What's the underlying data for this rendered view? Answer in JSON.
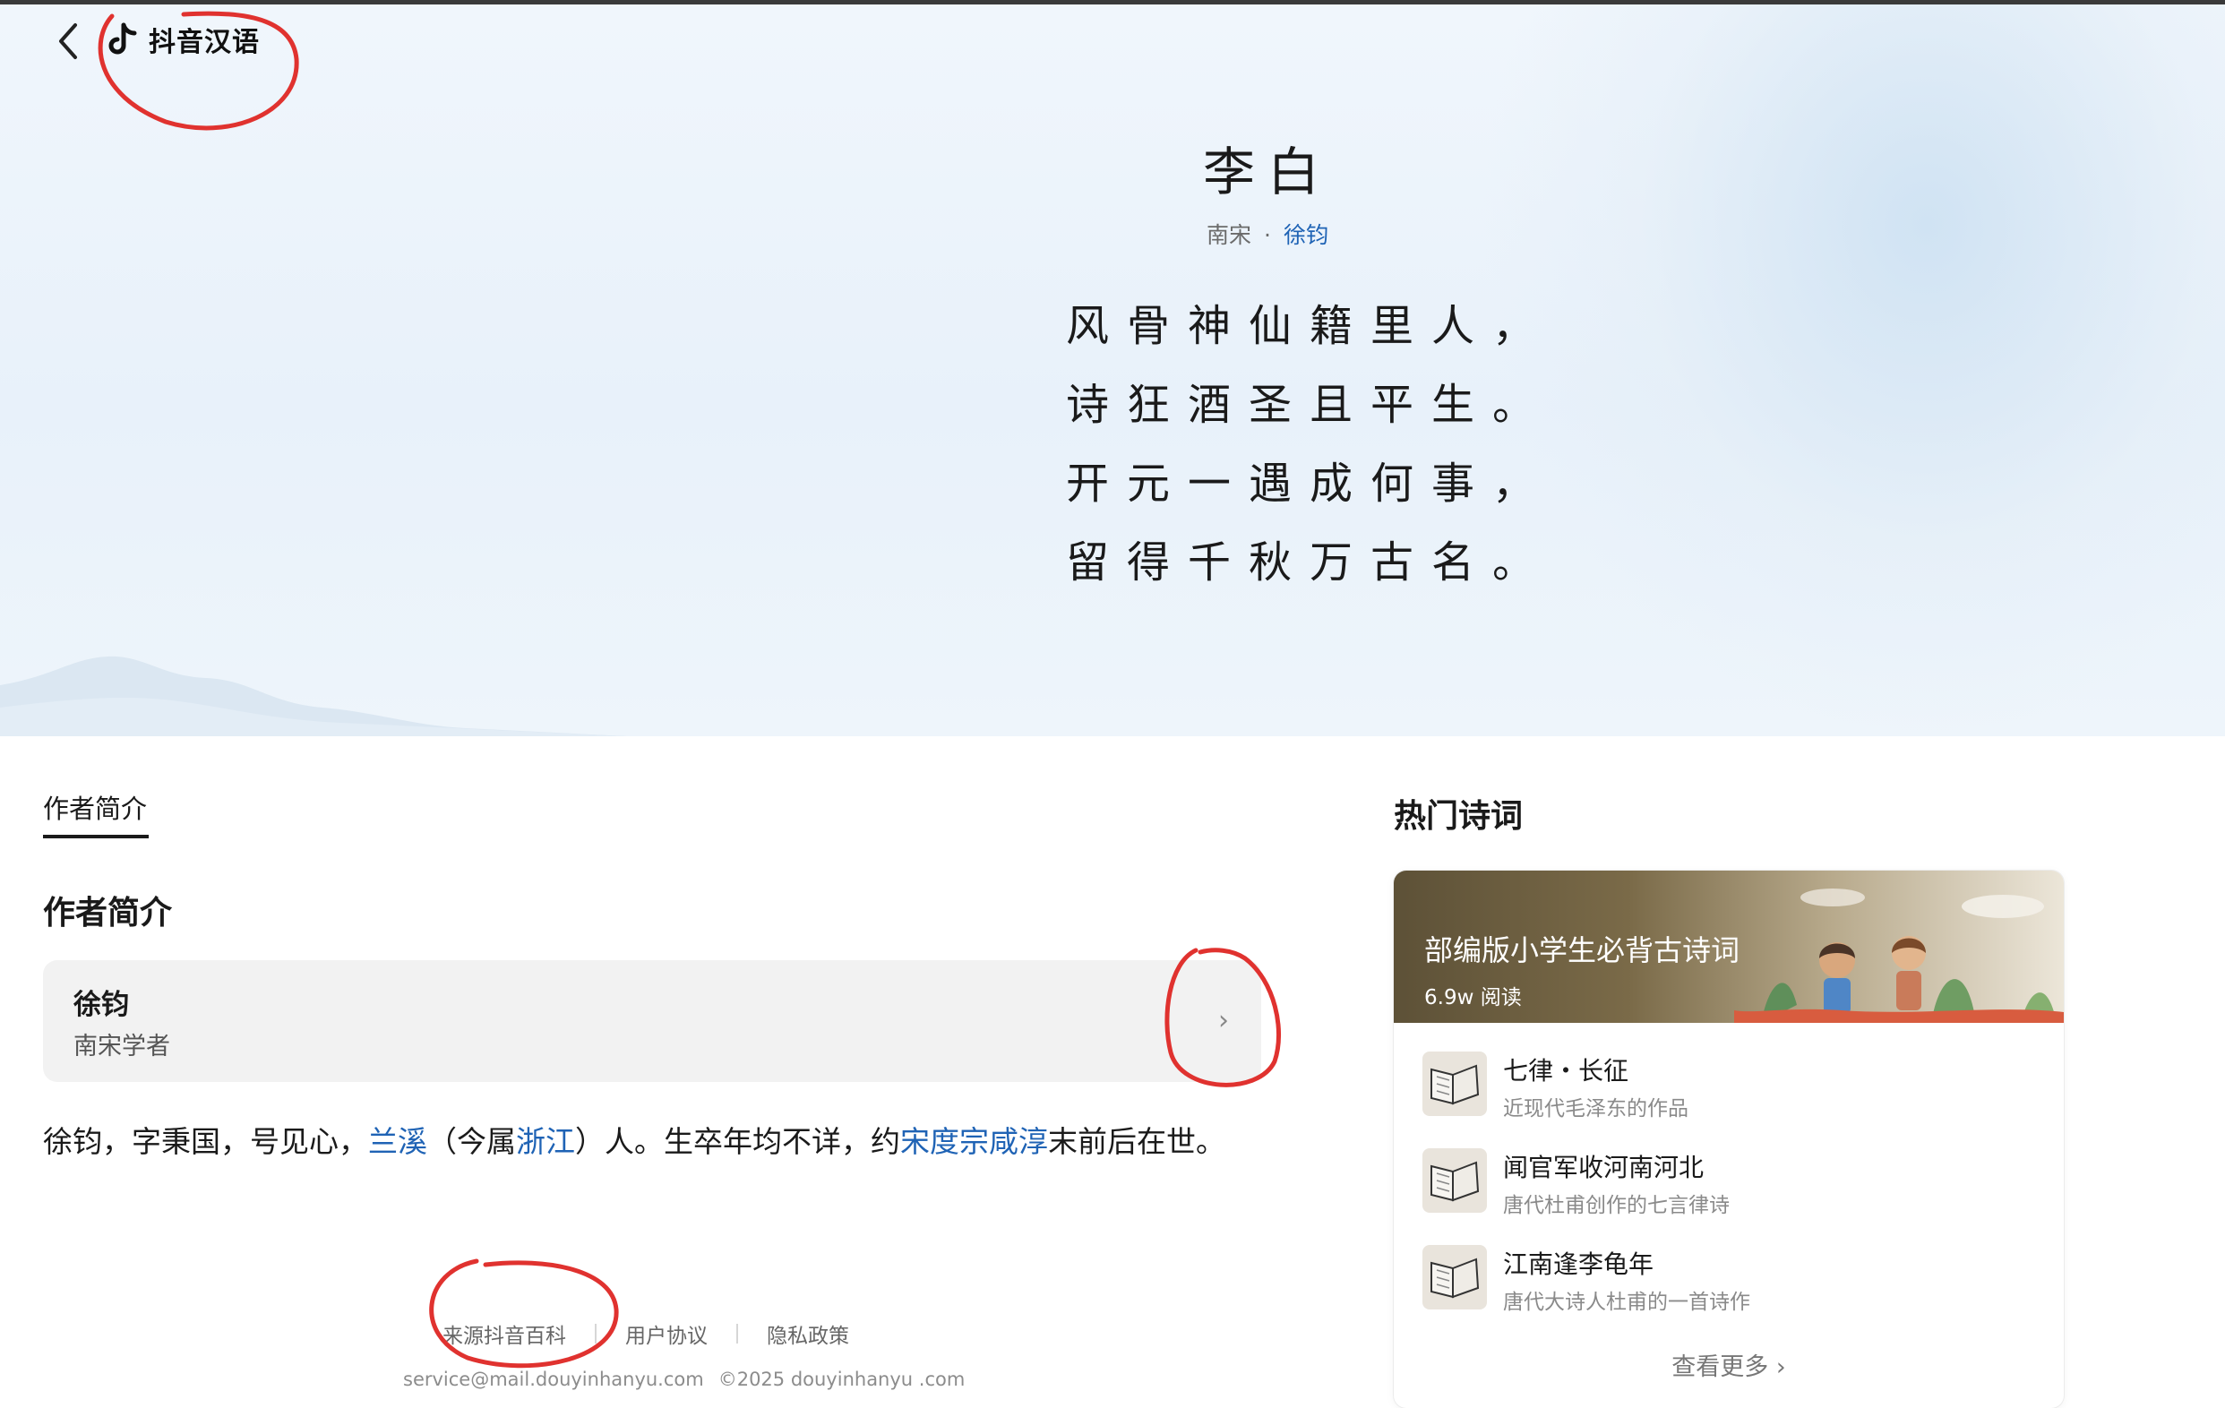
{
  "header": {
    "brand_name": "抖音汉语",
    "back_icon": "chevron-left-icon",
    "logo_icon": "douyin-note-icon"
  },
  "poem": {
    "title": "李白",
    "dynasty": "南宋",
    "separator": "·",
    "author": "徐钧",
    "lines": [
      "风骨神仙籍里人，",
      "诗狂酒圣且平生。",
      "开元一遇成何事，",
      "留得千秋万古名。"
    ]
  },
  "tabs": [
    {
      "label": "作者简介",
      "active": true
    }
  ],
  "author_section": {
    "title": "作者简介",
    "card": {
      "name": "徐钧",
      "subtitle": "南宋学者",
      "chevron_icon": "chevron-right-icon"
    },
    "bio": {
      "p1": "徐钧，字秉国，号见心，",
      "l1": "兰溪",
      "p2": "（今属",
      "l2": "浙江",
      "p3": "）人。生卒年均不详，约",
      "l3": "宋度宗咸淳",
      "p4": "末前后在世。"
    }
  },
  "hot": {
    "title": "热门诗词",
    "banner": {
      "title": "部编版小学生必背古诗词",
      "reads": "6.9w 阅读"
    },
    "items": [
      {
        "title": "七律・长征",
        "subtitle": "近现代毛泽东的作品",
        "icon": "book-icon"
      },
      {
        "title": "闻官军收河南河北",
        "subtitle": "唐代杜甫创作的七言律诗",
        "icon": "book-icon"
      },
      {
        "title": "江南逢李龟年",
        "subtitle": "唐代大诗人杜甫的一首诗作",
        "icon": "book-icon"
      }
    ],
    "more": "查看更多"
  },
  "footer": {
    "links": [
      "来源抖音百科",
      "用户协议",
      "隐私政策"
    ],
    "email": "service@mail.douyinhanyu.com",
    "copyright": "©2025 douyinhanyu .com"
  },
  "colors": {
    "link": "#1f63b5",
    "annotation": "#e0322f",
    "hero_background": "#e8f1fa"
  }
}
